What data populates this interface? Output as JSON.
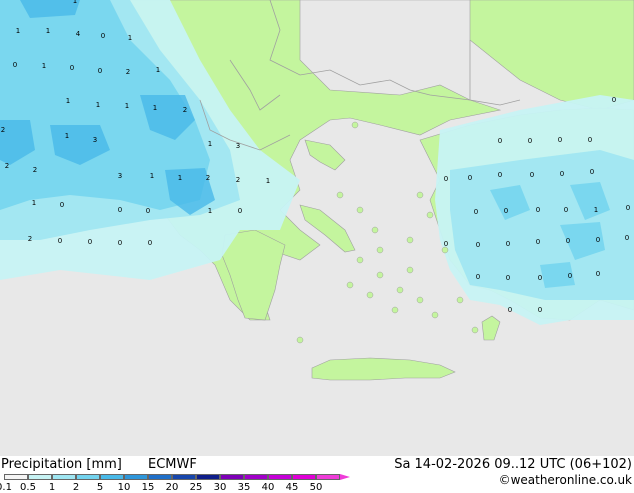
{
  "title": "Precipitation [mm]",
  "model": "ECMWF",
  "validity": "Sa 14-02-2026 09..12 UTC (06+102)",
  "credit": "©weatheronline.co.uk",
  "legend": {
    "labels": [
      "0.1",
      "0.5",
      "1",
      "2",
      "5",
      "10",
      "15",
      "20",
      "25",
      "30",
      "35",
      "40",
      "45",
      "50"
    ],
    "colors": [
      "#f5f5f5",
      "#c7f3f4",
      "#9fe6f2",
      "#73d3ee",
      "#49b9e8",
      "#2e96da",
      "#1f6fc8",
      "#1746ac",
      "#0f1e8a",
      "#7d00b6",
      "#a000c8",
      "#c400d7",
      "#df00d6",
      "#ee3cd8"
    ]
  },
  "colors": {
    "sea": "#e8e8e8",
    "land": "#c4f59e",
    "precip_light": "#c7f3f4",
    "precip_medium": "#9fe6f2",
    "precip_heavy": "#73d3ee",
    "precip_strong": "#49b9e8",
    "border": "#a0a0a0"
  },
  "map_values": [
    "1",
    "1",
    "0",
    "1",
    "1",
    "4",
    "0",
    "1",
    "0",
    "1",
    "0",
    "2",
    "2",
    "1",
    "1",
    "1",
    "1",
    "2",
    "2",
    "1",
    "3",
    "3",
    "1",
    "1",
    "2",
    "2",
    "1",
    "1",
    "3",
    "2",
    "0",
    "1",
    "0",
    "0",
    "1",
    "0",
    "2",
    "0",
    "0",
    "0",
    "0",
    "0",
    "0",
    "0",
    "0",
    "0",
    "0",
    "0",
    "0",
    "0",
    "0",
    "0",
    "0",
    "0",
    "0",
    "0",
    "1",
    "0",
    "0",
    "0",
    "0",
    "0",
    "0",
    "0",
    "0",
    "0",
    "0",
    "0",
    "0",
    "0",
    "0",
    "0"
  ]
}
